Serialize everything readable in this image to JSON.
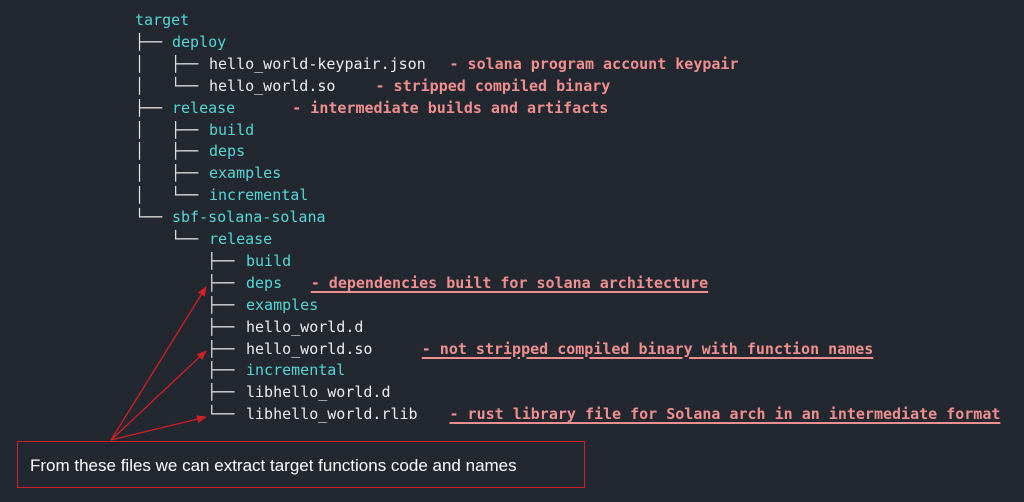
{
  "tree": [
    {
      "branch": "",
      "name": "target",
      "kind": "dir",
      "note": "",
      "underline": false
    },
    {
      "branch": "├── ",
      "name": "deploy",
      "kind": "dir",
      "note": "",
      "underline": false
    },
    {
      "branch": "│   ├── ",
      "name": "hello_world-keypair.json",
      "kind": "file",
      "note": "- solana program account keypair",
      "underline": false
    },
    {
      "branch": "│   └── ",
      "name": "hello_world.so",
      "kind": "file",
      "note": "- stripped compiled binary",
      "underline": false
    },
    {
      "branch": "├── ",
      "name": "release",
      "kind": "dir",
      "note": "- intermediate builds and artifacts",
      "underline": false
    },
    {
      "branch": "│   ├── ",
      "name": "build",
      "kind": "dir",
      "note": "",
      "underline": false
    },
    {
      "branch": "│   ├── ",
      "name": "deps",
      "kind": "dir",
      "note": "",
      "underline": false
    },
    {
      "branch": "│   ├── ",
      "name": "examples",
      "kind": "dir",
      "note": "",
      "underline": false
    },
    {
      "branch": "│   └── ",
      "name": "incremental",
      "kind": "dir",
      "note": "",
      "underline": false
    },
    {
      "branch": "└── ",
      "name": "sbf-solana-solana",
      "kind": "dir",
      "note": "",
      "underline": false
    },
    {
      "branch": "    └── ",
      "name": "release",
      "kind": "dir",
      "note": "",
      "underline": false
    },
    {
      "branch": "        ├── ",
      "name": "build",
      "kind": "dir",
      "note": "",
      "underline": false
    },
    {
      "branch": "        ├── ",
      "name": "deps",
      "kind": "dir",
      "note": "- dependencies built for solana architecture",
      "underline": true
    },
    {
      "branch": "        ├── ",
      "name": "examples",
      "kind": "dir",
      "note": "",
      "underline": false
    },
    {
      "branch": "        ├── ",
      "name": "hello_world.d",
      "kind": "file",
      "note": "",
      "underline": false
    },
    {
      "branch": "        ├── ",
      "name": "hello_world.so",
      "kind": "file",
      "note": "- not stripped compiled binary with function names",
      "underline": true
    },
    {
      "branch": "        ├── ",
      "name": "incremental",
      "kind": "dir",
      "note": "",
      "underline": false
    },
    {
      "branch": "        ├── ",
      "name": "libhello_world.d",
      "kind": "file",
      "note": "",
      "underline": false
    },
    {
      "branch": "        └── ",
      "name": "libhello_world.rlib",
      "kind": "file",
      "note": "- rust library file for Solana arch in an intermediate format",
      "underline": true
    }
  ],
  "callout": {
    "text": "From these files we can extract target functions code and names"
  },
  "colors": {
    "background": "#232730",
    "directory": "#4fd8d8",
    "file": "#eeeeee",
    "note": "#f08f8f",
    "arrow": "#d01f26"
  }
}
